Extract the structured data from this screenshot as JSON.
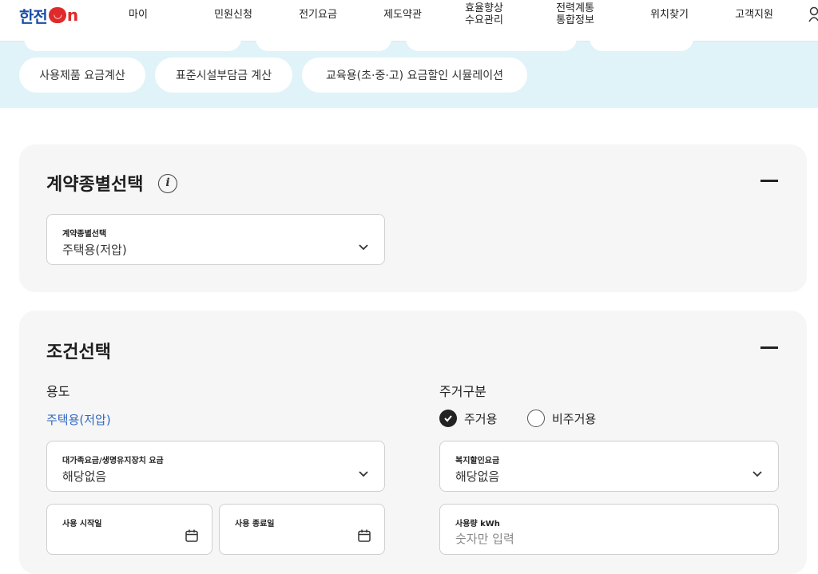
{
  "header": {
    "logo_text": "한전",
    "logo_on": "ON",
    "nav": [
      {
        "label": "마이"
      },
      {
        "label": "민원신청"
      },
      {
        "label": "전기요금"
      },
      {
        "label": "제도약관"
      },
      {
        "label": "효율향상",
        "label2": "수요관리"
      },
      {
        "label": "전력계통",
        "label2": "통합정보"
      },
      {
        "label": "위치찾기"
      },
      {
        "label": "고객지원"
      }
    ]
  },
  "category_pills": [
    {
      "label": "사용제품 요금계산"
    },
    {
      "label": "표준시설부담금 계산"
    },
    {
      "label": "교육용(초·중·고) 요금할인 시뮬레이션"
    }
  ],
  "contract_section": {
    "title": "계약종별선택",
    "select": {
      "label": "계약종별선택",
      "value": "주택용(저압)"
    }
  },
  "condition_section": {
    "title": "조건선택",
    "usage_label": "용도",
    "usage_value": "주택용(저압)",
    "residence_label": "주거구분",
    "residence_options": [
      {
        "label": "주거용",
        "checked": true
      },
      {
        "label": "비주거용",
        "checked": false
      }
    ],
    "family_select": {
      "label": "대가족요금/생명유지장치 요금",
      "value": "해당없음"
    },
    "welfare_select": {
      "label": "복지할인요금",
      "value": "해당없음"
    },
    "start_date": {
      "label": "사용 시작일"
    },
    "end_date": {
      "label": "사용 종료일"
    },
    "usage_input": {
      "label": "사용량 kWh",
      "placeholder": "숫자만 입력"
    }
  }
}
